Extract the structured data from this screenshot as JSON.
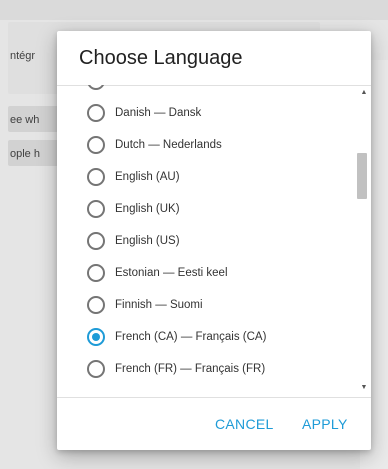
{
  "background": {
    "snippets": [
      "ntégr",
      "ee wh",
      "ople h"
    ]
  },
  "dialog": {
    "title": "Choose Language",
    "selected": "French (CA) — Français (CA)",
    "items": [
      {
        "label": "",
        "checked": false
      },
      {
        "label": "Danish — Dansk",
        "checked": false
      },
      {
        "label": "Dutch — Nederlands",
        "checked": false
      },
      {
        "label": "English (AU)",
        "checked": false
      },
      {
        "label": "English (UK)",
        "checked": false
      },
      {
        "label": "English (US)",
        "checked": false
      },
      {
        "label": "Estonian — Eesti keel",
        "checked": false
      },
      {
        "label": "Finnish — Suomi",
        "checked": false
      },
      {
        "label": "French (CA) — Français (CA)",
        "checked": true
      },
      {
        "label": "French (FR) — Français (FR)",
        "checked": false
      }
    ],
    "cancel_label": "CANCEL",
    "apply_label": "APPLY"
  },
  "colors": {
    "accent": "#1e9bd7",
    "radio_unchecked": "#757575",
    "title_text": "#212121"
  },
  "icons": {
    "scroll_up": "chevron-up-icon",
    "scroll_down": "chevron-down-icon"
  }
}
